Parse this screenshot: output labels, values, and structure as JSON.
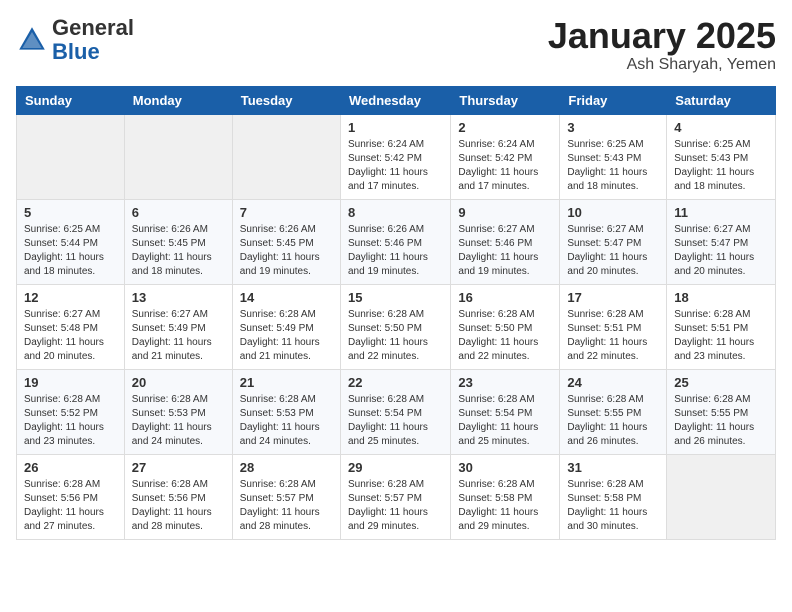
{
  "header": {
    "logo_general": "General",
    "logo_blue": "Blue",
    "month_title": "January 2025",
    "location": "Ash Sharyah, Yemen"
  },
  "days_of_week": [
    "Sunday",
    "Monday",
    "Tuesday",
    "Wednesday",
    "Thursday",
    "Friday",
    "Saturday"
  ],
  "weeks": [
    [
      {
        "day": "",
        "sunrise": "",
        "sunset": "",
        "daylight": ""
      },
      {
        "day": "",
        "sunrise": "",
        "sunset": "",
        "daylight": ""
      },
      {
        "day": "",
        "sunrise": "",
        "sunset": "",
        "daylight": ""
      },
      {
        "day": "1",
        "sunrise": "Sunrise: 6:24 AM",
        "sunset": "Sunset: 5:42 PM",
        "daylight": "Daylight: 11 hours and 17 minutes."
      },
      {
        "day": "2",
        "sunrise": "Sunrise: 6:24 AM",
        "sunset": "Sunset: 5:42 PM",
        "daylight": "Daylight: 11 hours and 17 minutes."
      },
      {
        "day": "3",
        "sunrise": "Sunrise: 6:25 AM",
        "sunset": "Sunset: 5:43 PM",
        "daylight": "Daylight: 11 hours and 18 minutes."
      },
      {
        "day": "4",
        "sunrise": "Sunrise: 6:25 AM",
        "sunset": "Sunset: 5:43 PM",
        "daylight": "Daylight: 11 hours and 18 minutes."
      }
    ],
    [
      {
        "day": "5",
        "sunrise": "Sunrise: 6:25 AM",
        "sunset": "Sunset: 5:44 PM",
        "daylight": "Daylight: 11 hours and 18 minutes."
      },
      {
        "day": "6",
        "sunrise": "Sunrise: 6:26 AM",
        "sunset": "Sunset: 5:45 PM",
        "daylight": "Daylight: 11 hours and 18 minutes."
      },
      {
        "day": "7",
        "sunrise": "Sunrise: 6:26 AM",
        "sunset": "Sunset: 5:45 PM",
        "daylight": "Daylight: 11 hours and 19 minutes."
      },
      {
        "day": "8",
        "sunrise": "Sunrise: 6:26 AM",
        "sunset": "Sunset: 5:46 PM",
        "daylight": "Daylight: 11 hours and 19 minutes."
      },
      {
        "day": "9",
        "sunrise": "Sunrise: 6:27 AM",
        "sunset": "Sunset: 5:46 PM",
        "daylight": "Daylight: 11 hours and 19 minutes."
      },
      {
        "day": "10",
        "sunrise": "Sunrise: 6:27 AM",
        "sunset": "Sunset: 5:47 PM",
        "daylight": "Daylight: 11 hours and 20 minutes."
      },
      {
        "day": "11",
        "sunrise": "Sunrise: 6:27 AM",
        "sunset": "Sunset: 5:47 PM",
        "daylight": "Daylight: 11 hours and 20 minutes."
      }
    ],
    [
      {
        "day": "12",
        "sunrise": "Sunrise: 6:27 AM",
        "sunset": "Sunset: 5:48 PM",
        "daylight": "Daylight: 11 hours and 20 minutes."
      },
      {
        "day": "13",
        "sunrise": "Sunrise: 6:27 AM",
        "sunset": "Sunset: 5:49 PM",
        "daylight": "Daylight: 11 hours and 21 minutes."
      },
      {
        "day": "14",
        "sunrise": "Sunrise: 6:28 AM",
        "sunset": "Sunset: 5:49 PM",
        "daylight": "Daylight: 11 hours and 21 minutes."
      },
      {
        "day": "15",
        "sunrise": "Sunrise: 6:28 AM",
        "sunset": "Sunset: 5:50 PM",
        "daylight": "Daylight: 11 hours and 22 minutes."
      },
      {
        "day": "16",
        "sunrise": "Sunrise: 6:28 AM",
        "sunset": "Sunset: 5:50 PM",
        "daylight": "Daylight: 11 hours and 22 minutes."
      },
      {
        "day": "17",
        "sunrise": "Sunrise: 6:28 AM",
        "sunset": "Sunset: 5:51 PM",
        "daylight": "Daylight: 11 hours and 22 minutes."
      },
      {
        "day": "18",
        "sunrise": "Sunrise: 6:28 AM",
        "sunset": "Sunset: 5:51 PM",
        "daylight": "Daylight: 11 hours and 23 minutes."
      }
    ],
    [
      {
        "day": "19",
        "sunrise": "Sunrise: 6:28 AM",
        "sunset": "Sunset: 5:52 PM",
        "daylight": "Daylight: 11 hours and 23 minutes."
      },
      {
        "day": "20",
        "sunrise": "Sunrise: 6:28 AM",
        "sunset": "Sunset: 5:53 PM",
        "daylight": "Daylight: 11 hours and 24 minutes."
      },
      {
        "day": "21",
        "sunrise": "Sunrise: 6:28 AM",
        "sunset": "Sunset: 5:53 PM",
        "daylight": "Daylight: 11 hours and 24 minutes."
      },
      {
        "day": "22",
        "sunrise": "Sunrise: 6:28 AM",
        "sunset": "Sunset: 5:54 PM",
        "daylight": "Daylight: 11 hours and 25 minutes."
      },
      {
        "day": "23",
        "sunrise": "Sunrise: 6:28 AM",
        "sunset": "Sunset: 5:54 PM",
        "daylight": "Daylight: 11 hours and 25 minutes."
      },
      {
        "day": "24",
        "sunrise": "Sunrise: 6:28 AM",
        "sunset": "Sunset: 5:55 PM",
        "daylight": "Daylight: 11 hours and 26 minutes."
      },
      {
        "day": "25",
        "sunrise": "Sunrise: 6:28 AM",
        "sunset": "Sunset: 5:55 PM",
        "daylight": "Daylight: 11 hours and 26 minutes."
      }
    ],
    [
      {
        "day": "26",
        "sunrise": "Sunrise: 6:28 AM",
        "sunset": "Sunset: 5:56 PM",
        "daylight": "Daylight: 11 hours and 27 minutes."
      },
      {
        "day": "27",
        "sunrise": "Sunrise: 6:28 AM",
        "sunset": "Sunset: 5:56 PM",
        "daylight": "Daylight: 11 hours and 28 minutes."
      },
      {
        "day": "28",
        "sunrise": "Sunrise: 6:28 AM",
        "sunset": "Sunset: 5:57 PM",
        "daylight": "Daylight: 11 hours and 28 minutes."
      },
      {
        "day": "29",
        "sunrise": "Sunrise: 6:28 AM",
        "sunset": "Sunset: 5:57 PM",
        "daylight": "Daylight: 11 hours and 29 minutes."
      },
      {
        "day": "30",
        "sunrise": "Sunrise: 6:28 AM",
        "sunset": "Sunset: 5:58 PM",
        "daylight": "Daylight: 11 hours and 29 minutes."
      },
      {
        "day": "31",
        "sunrise": "Sunrise: 6:28 AM",
        "sunset": "Sunset: 5:58 PM",
        "daylight": "Daylight: 11 hours and 30 minutes."
      },
      {
        "day": "",
        "sunrise": "",
        "sunset": "",
        "daylight": ""
      }
    ]
  ]
}
